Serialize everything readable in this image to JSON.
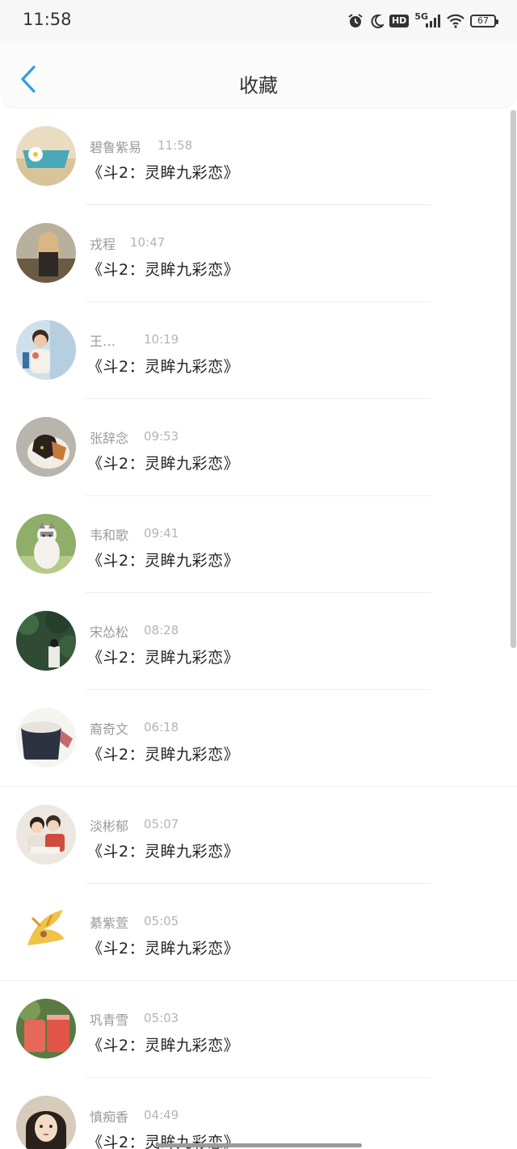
{
  "status_bar": {
    "time": "11:58",
    "network": "5G",
    "hd": "HD",
    "battery": "67",
    "icons": [
      "alarm-icon",
      "moon-icon",
      "hd-icon",
      "signal-icon",
      "wifi-icon",
      "battery-icon"
    ]
  },
  "header": {
    "title": "收藏",
    "back_icon": "chevron-left-icon",
    "accent_color": "#2e9fe6"
  },
  "favorites": [
    {
      "name": "碧鲁紫易",
      "time": "11:58",
      "content": "《斗2：灵眸九彩恋》"
    },
    {
      "name": "戎程",
      "time": "10:47",
      "content": "《斗2：灵眸九彩恋》"
    },
    {
      "name": "王…",
      "time": "10:19",
      "content": "《斗2：灵眸九彩恋》"
    },
    {
      "name": "张辞念",
      "time": "09:53",
      "content": "《斗2：灵眸九彩恋》"
    },
    {
      "name": "韦和歌",
      "time": "09:41",
      "content": "《斗2：灵眸九彩恋》"
    },
    {
      "name": "宋怂松",
      "time": "08:28",
      "content": "《斗2：灵眸九彩恋》"
    },
    {
      "name": "裔奇文",
      "time": "06:18",
      "content": "《斗2：灵眸九彩恋》"
    },
    {
      "name": "淡彬郁",
      "time": "05:07",
      "content": "《斗2：灵眸九彩恋》"
    },
    {
      "name": "綦紫萱",
      "time": "05:05",
      "content": "《斗2：灵眸九彩恋》"
    },
    {
      "name": "巩青雪",
      "time": "05:03",
      "content": "《斗2：灵眸九彩恋》"
    },
    {
      "name": "慎痴香",
      "time": "04:49",
      "content": "《斗2：灵眸九彩恋》"
    }
  ]
}
